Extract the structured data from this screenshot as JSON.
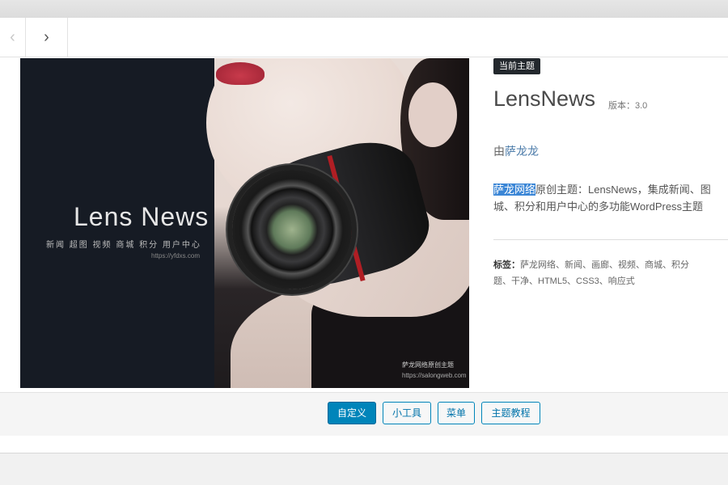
{
  "nav": {
    "prev_glyph": "‹",
    "next_glyph": "›"
  },
  "screenshot": {
    "title": "Lens News",
    "subtitle": "新闻 超图 视频 商城 积分 用户中心",
    "url": "https://yfdxs.com",
    "watermark_line1": "萨龙网络原创主题",
    "watermark_line2": "https://salongweb.com"
  },
  "theme": {
    "badge": "当前主题",
    "name": "LensNews",
    "version": "版本：3.0",
    "author_prefix": "由",
    "author": "萨龙龙",
    "desc_highlight": "萨龙网络",
    "desc_line1_rest": "原创主题：LensNews，集成新闻、图",
    "desc_line2": "城、积分和用户中心的多功能WordPress主题",
    "tags_label": "标签：",
    "tags_line1": "萨龙网络、新闻、画廊、视频、商城、积分",
    "tags_line2": "题、干净、HTML5、CSS3、响应式"
  },
  "footer": {
    "customize": "自定义",
    "widgets": "小工具",
    "menus": "菜单",
    "tutorial": "主题教程"
  }
}
